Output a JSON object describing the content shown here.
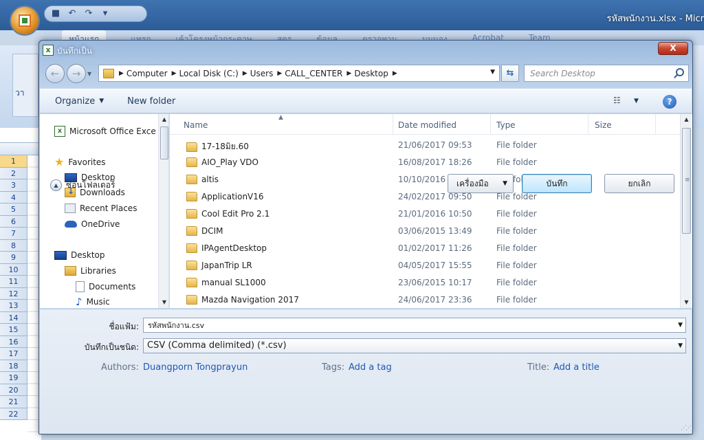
{
  "excel": {
    "title": "รหัสพนักงาน.xlsx - Micr",
    "ribbon_tabs": [
      "หน้าแรก",
      "แทรก",
      "เค้าโครงหน้ากระดาษ",
      "สูตร",
      "ข้อมูล",
      "ตรวจทาน",
      "มุมมอง",
      "Acrobat",
      "Team"
    ],
    "paste_label": "วา",
    "rows": [
      "1",
      "2",
      "3",
      "4",
      "5",
      "6",
      "7",
      "8",
      "9",
      "10",
      "11",
      "12",
      "13",
      "14",
      "15",
      "16",
      "17",
      "18",
      "19",
      "20",
      "21",
      "22"
    ]
  },
  "dialog": {
    "title": "บันทึกเป็น",
    "close_label": "X",
    "breadcrumbs": [
      "Computer",
      "Local Disk (C:)",
      "Users",
      "CALL_CENTER",
      "Desktop"
    ],
    "search_placeholder": "Search Desktop",
    "toolbar": {
      "organize": "Organize",
      "new_folder": "New folder"
    },
    "nav_items": {
      "app": "Microsoft Office Exce",
      "favorites": "Favorites",
      "fav_desktop": "Desktop",
      "downloads": "Downloads",
      "recent_places": "Recent Places",
      "onedrive": "OneDrive",
      "desktop": "Desktop",
      "libraries": "Libraries",
      "documents": "Documents",
      "music": "Music"
    },
    "columns": {
      "name": "Name",
      "date": "Date modified",
      "type": "Type",
      "size": "Size"
    },
    "files": [
      {
        "name": "17-18มิย.60",
        "date": "21/06/2017 09:53",
        "type": "File folder"
      },
      {
        "name": "AIO_Play VDO",
        "date": "16/08/2017 18:26",
        "type": "File folder"
      },
      {
        "name": "altis",
        "date": "10/10/2016 13:55",
        "type": "File folder"
      },
      {
        "name": "ApplicationV16",
        "date": "24/02/2017 09:50",
        "type": "File folder"
      },
      {
        "name": "Cool Edit Pro 2.1",
        "date": "21/01/2016 10:50",
        "type": "File folder"
      },
      {
        "name": "DCIM",
        "date": "03/06/2015 13:49",
        "type": "File folder"
      },
      {
        "name": "IPAgentDesktop",
        "date": "01/02/2017 11:26",
        "type": "File folder"
      },
      {
        "name": "JapanTrip LR",
        "date": "04/05/2017 15:55",
        "type": "File folder"
      },
      {
        "name": "manual SL1000",
        "date": "23/06/2015 10:17",
        "type": "File folder"
      },
      {
        "name": "Mazda Navigation 2017",
        "date": "24/06/2017 23:36",
        "type": "File folder"
      }
    ],
    "form": {
      "filename_label": "ชื่อแฟ้ม:",
      "filename_value": "รหัสพนักงาน.csv",
      "savetype_label": "บันทึกเป็นชนิด:",
      "savetype_value": "CSV (Comma delimited) (*.csv)",
      "authors_label": "Authors:",
      "authors_value": "Duangporn Tongprayun",
      "tags_label": "Tags:",
      "tags_value": "Add a tag",
      "title_label": "Title:",
      "title_value": "Add a title"
    },
    "buttons": {
      "hide_folders": "ซ่อนโฟลเดอร์",
      "tools": "เครื่องมือ",
      "save": "บันทึก",
      "cancel": "ยกเลิก"
    }
  }
}
